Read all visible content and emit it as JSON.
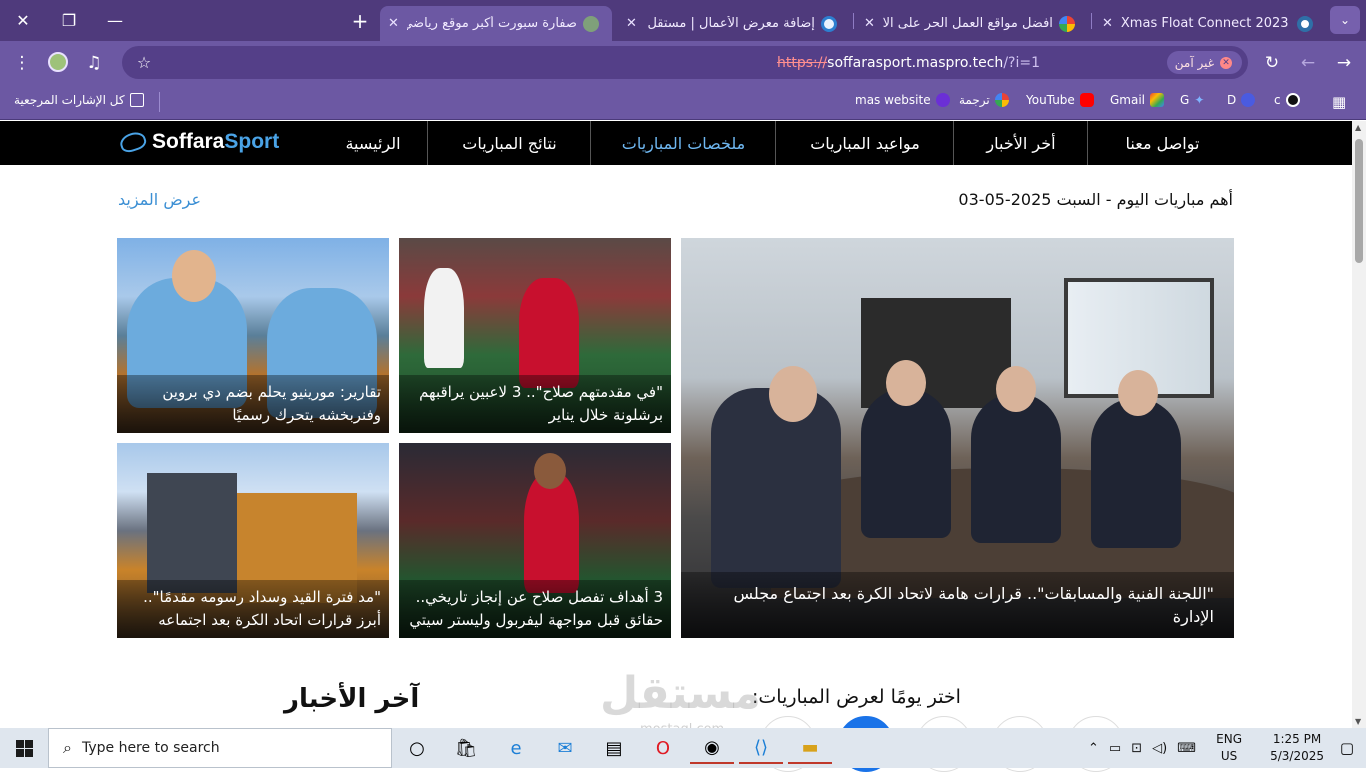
{
  "browser": {
    "tabs": [
      {
        "title": "Xmas Float Connect 2023",
        "favicon": "wordpress-icon"
      },
      {
        "title": "افضل مواقع العمل الحر على الانترنت",
        "favicon": "google-icon"
      },
      {
        "title": "إضافة معرض الأعمال | مستقل",
        "favicon": "mostaql-icon"
      },
      {
        "title": "صفارة سبورت أكبر موقع رياضي",
        "favicon": "soffara-icon",
        "active": true
      }
    ],
    "url": {
      "scheme": "https://",
      "host": "soffarasport.maspro.tech",
      "path": "/?i=1"
    },
    "security_label": "غير آمن",
    "bookmarks": [
      {
        "label": "كل الإشارات المرجعية"
      },
      {
        "label": "mas website"
      },
      {
        "label": "ترجمة"
      },
      {
        "label": "YouTube"
      },
      {
        "label": "Gmail"
      },
      {
        "label": "G"
      },
      {
        "label": "D"
      },
      {
        "label": "c"
      }
    ]
  },
  "site": {
    "logo": {
      "part1": "Soffara",
      "part2": "Sport"
    },
    "nav": [
      {
        "label": "تواصل معنا"
      },
      {
        "label": "أخر الأخبار"
      },
      {
        "label": "مواعيد المباريات"
      },
      {
        "label": "ملخصات المباريات"
      },
      {
        "label": "نتائج المباريات"
      },
      {
        "label": "الرئيسية"
      }
    ],
    "section_title": "أهم مباريات اليوم - السبت 2025-05-03",
    "more_link": "عرض المزيد",
    "cards": [
      {
        "caption": "\"اللجنة الفنية والمسابقات\".. قرارات هامة لاتحاد الكرة بعد اجتماع مجلس الإدارة"
      },
      {
        "caption": "\"في مقدمتهم صلاح\".. 3 لاعبين يراقبهم برشلونة خلال يناير"
      },
      {
        "caption": "تقارير: مورينيو يحلم بضم دي بروين وفنربخشه يتحرك رسميًا"
      },
      {
        "caption": "3 أهداف تفصل صلاح عن إنجاز تاريخي.. حقائق قبل مواجهة ليفربول وليستر سيتي"
      },
      {
        "caption": "\"مد فترة القيد وسداد رسومه مقدمًا\".. أبرز قرارات اتحاد الكرة بعد اجتماعه"
      }
    ],
    "pick_day": "اختر يومًا لعرض المباريات:",
    "latest_news": "آخر الأخبار",
    "watermark": "مستقل",
    "watermark_sub": "mostaql.com"
  },
  "taskbar": {
    "search_placeholder": "Type here to search",
    "lang_line1": "ENG",
    "lang_line2": "US",
    "time": "1:25 PM",
    "date": "5/3/2025"
  },
  "colors": {
    "browser_frame": "#4f3a7c",
    "toolbar": "#6c58a3",
    "site_nav": "#000000",
    "accent_blue": "#3b8fd4"
  }
}
